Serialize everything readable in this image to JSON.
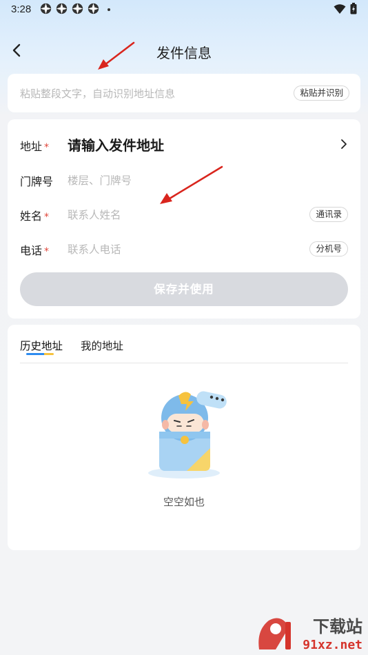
{
  "status_bar": {
    "time": "3:28"
  },
  "header": {
    "title": "发件信息"
  },
  "paste": {
    "placeholder": "粘贴整段文字，自动识别地址信息",
    "button": "粘贴并识别"
  },
  "form": {
    "address": {
      "label": "地址",
      "value": "请输入发件地址"
    },
    "door": {
      "label": "门牌号",
      "placeholder": "楼层、门牌号"
    },
    "name": {
      "label": "姓名",
      "placeholder": "联系人姓名",
      "button": "通讯录"
    },
    "phone": {
      "label": "电话",
      "placeholder": "联系人电话",
      "button": "分机号"
    },
    "required_mark": "*",
    "save_label": "保存并使用"
  },
  "history": {
    "tabs": [
      "历史地址",
      "我的地址"
    ],
    "active_tab": 0,
    "empty_text": "空空如也"
  },
  "watermark": {
    "line1": "下载站",
    "line2": "91xz.net"
  },
  "colors": {
    "required": "#e0463a",
    "tab_accent": "#2d8cf0",
    "tab_accent_2": "#f6c23e",
    "annotation_arrow": "#d9251d",
    "button_disabled": "#d8dadf"
  }
}
